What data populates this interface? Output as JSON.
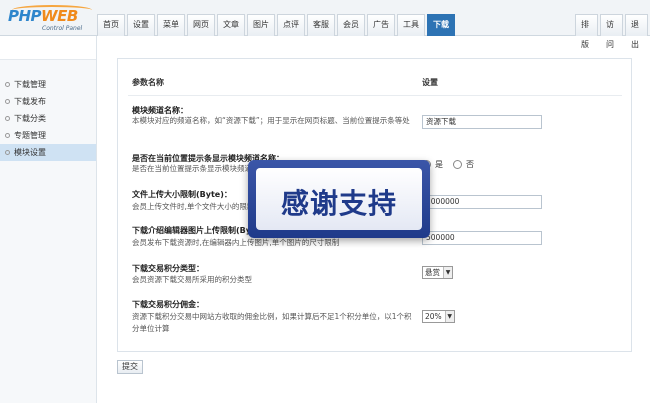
{
  "logo": {
    "brand_main": "PHP",
    "brand_accent": "WEB",
    "subtitle": "Control Panel"
  },
  "nav": {
    "tabs": [
      "首页",
      "设置",
      "菜单",
      "网页",
      "文章",
      "图片",
      "点评",
      "客服",
      "会员",
      "广告",
      "工具",
      "下载"
    ],
    "active_tab": "下载",
    "right_tabs": [
      "排版",
      "访问",
      "退出"
    ]
  },
  "sidebar": {
    "items": [
      "下载管理",
      "下载发布",
      "下载分类",
      "专题管理",
      "模块设置"
    ],
    "active_item": "模块设置"
  },
  "table": {
    "col_name": "参数名称",
    "col_setting": "设置",
    "rows": [
      {
        "title": "模块频道名称：",
        "desc": "本模块对应的频道名称，如“资源下载”；用于显示在网页标题、当前位置提示条等处",
        "value": "资源下载"
      },
      {
        "title": "是否在当前位置提示条显示模块频道名称：",
        "desc": "是否在当前位置提示条显示模块频道名称",
        "yes": "是",
        "no": "否"
      },
      {
        "title": "文件上传大小限制(Byte)：",
        "desc": "会员上传文件时,单个文件大小的限制",
        "value": "2000000"
      },
      {
        "title": "下载介绍编辑器图片上传限制(Byte)：",
        "desc": "会员发布下载资源时,在编辑器内上传图片,单个图片的尺寸限制",
        "value": "500000"
      },
      {
        "title": "下载交易积分类型：",
        "desc": "会员资源下载交易所采用的积分类型",
        "value": "悬赏"
      },
      {
        "title": "下载交易积分佣金：",
        "desc": "资源下载积分交易中网站方收取的佣金比例，如果计算后不足1个积分单位，以1个积分单位计算",
        "value": "20%"
      }
    ]
  },
  "submit_label": "提交",
  "overlay": {
    "text": "感谢支持"
  },
  "colors": {
    "accent": "#2d73b4",
    "active_bg": "#cfe2f3",
    "banner": "#1f3a8a"
  }
}
